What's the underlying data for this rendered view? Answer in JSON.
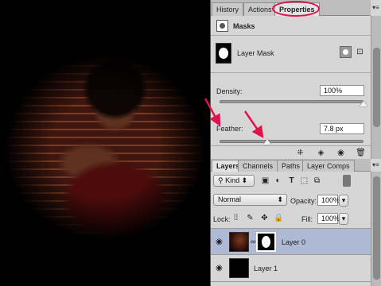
{
  "properties_panel": {
    "tabs": [
      {
        "label": "History"
      },
      {
        "label": "Actions"
      },
      {
        "label": "Properties"
      }
    ],
    "section_title": "Masks",
    "layer_mask_label": "Layer Mask",
    "density": {
      "label": "Density:",
      "value": "100%",
      "level_percent": 100
    },
    "feather": {
      "label": "Feather:",
      "value": "7.8 px",
      "level_fraction": 0.24
    }
  },
  "layers_panel": {
    "tabs": [
      {
        "label": "Layers"
      },
      {
        "label": "Channels"
      },
      {
        "label": "Paths"
      },
      {
        "label": "Layer Comps"
      }
    ],
    "filter_kind": "Kind",
    "blend_mode": "Normal",
    "opacity_label": "Opacity:",
    "opacity_value": "100%",
    "lock_label": "Lock:",
    "fill_label": "Fill:",
    "fill_value": "100%",
    "layers": [
      {
        "name": "Layer 0",
        "selected": true
      },
      {
        "name": "Layer 1",
        "selected": false
      }
    ]
  },
  "colors": {
    "selected_row": "#aeb9d6",
    "annotation": "#e0124a"
  }
}
